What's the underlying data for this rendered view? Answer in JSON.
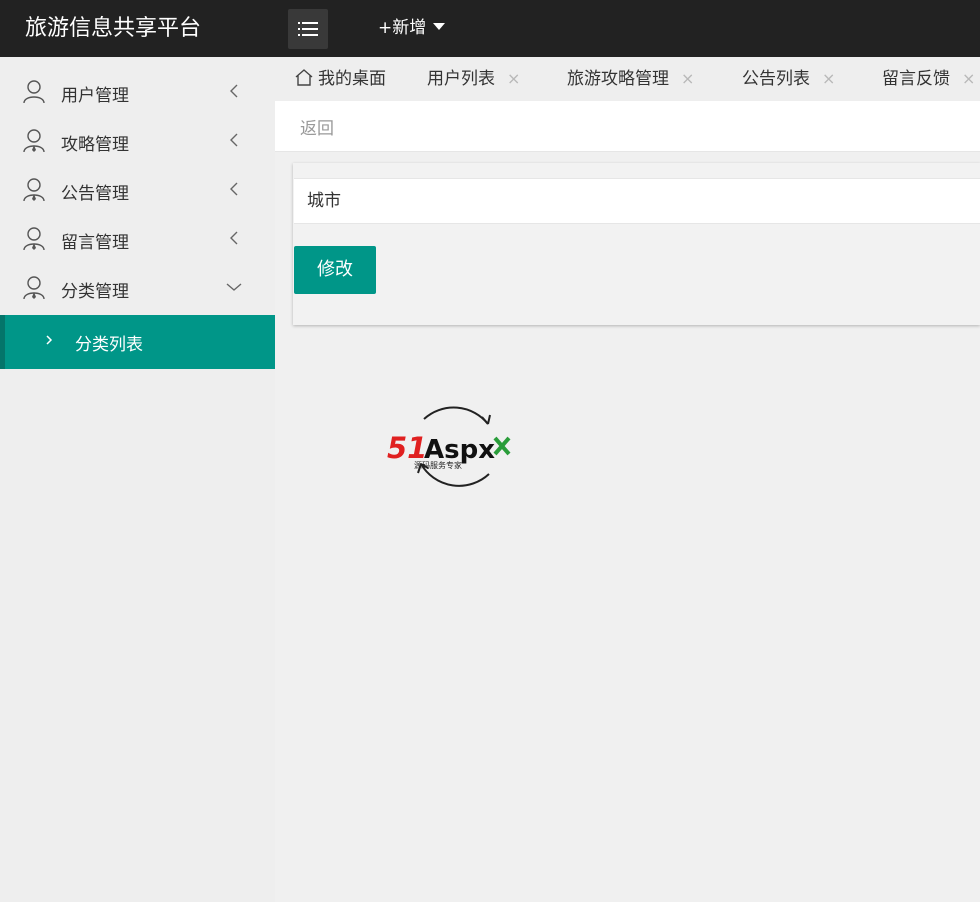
{
  "header": {
    "title": "旅游信息共享平台",
    "menu_icon": "hamburger-icon",
    "add_label": "+新增",
    "add_icon": "caret-down-icon"
  },
  "sidebar": {
    "items": [
      {
        "label": "用户管理",
        "icon": "user-icon",
        "chevron": "chevron-left"
      },
      {
        "label": "攻略管理",
        "icon": "user-icon",
        "chevron": "chevron-left"
      },
      {
        "label": "公告管理",
        "icon": "user-icon",
        "chevron": "chevron-left"
      },
      {
        "label": "留言管理",
        "icon": "user-icon",
        "chevron": "chevron-left"
      },
      {
        "label": "分类管理",
        "icon": "user-icon",
        "chevron": "chevron-down"
      }
    ],
    "active_sub": {
      "label": "分类列表",
      "icon": "chevron-right"
    }
  },
  "tabs": [
    {
      "label": "我的桌面",
      "icon": "home-icon",
      "closable": false
    },
    {
      "label": "用户列表",
      "closable": true
    },
    {
      "label": "旅游攻略管理",
      "closable": true
    },
    {
      "label": "公告列表",
      "closable": true
    },
    {
      "label": "留言反馈",
      "closable": true
    }
  ],
  "tab_close_glyph": "×",
  "content": {
    "back_label": "返回"
  },
  "form": {
    "field_value": "城市",
    "submit_label": "修改"
  },
  "watermark": {
    "brand_51": "51",
    "brand_aspx": "Aspx",
    "tagline": "源码服务专家"
  },
  "colors": {
    "header_bg": "#222222",
    "accent": "#009688",
    "sidebar_bg": "#eeeeee"
  }
}
